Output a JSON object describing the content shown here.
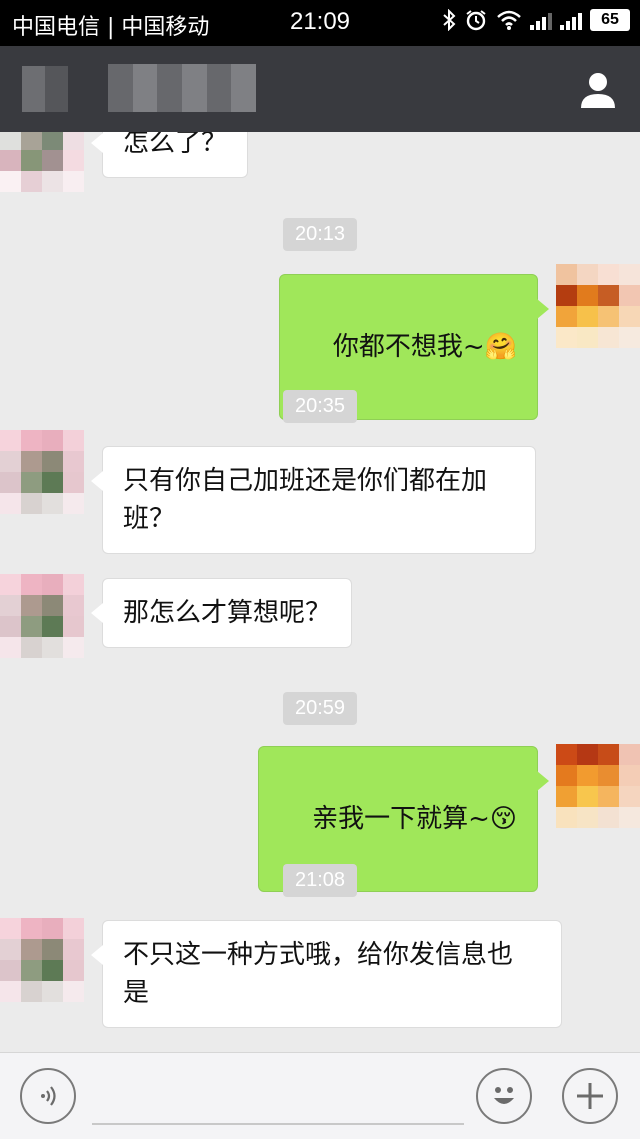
{
  "status_bar": {
    "carrier": "中国电信 | 中国移动",
    "time": "21:09",
    "bluetooth_icon": "bluetooth-icon",
    "alarm_icon": "alarm-icon",
    "battery": "65"
  },
  "header": {
    "back_icon": "blurred-back",
    "title": "",
    "profile_icon": "person-icon"
  },
  "messages": [
    {
      "type": "in",
      "text": "怎么了？"
    },
    {
      "type": "time",
      "text": "20:13"
    },
    {
      "type": "out",
      "text": "你都不想我~",
      "emoji": "🤗"
    },
    {
      "type": "time",
      "text": "20:35"
    },
    {
      "type": "in",
      "text": "只有你自己加班还是你们都在加\n班？"
    },
    {
      "type": "in",
      "text": "那怎么才算想呢？"
    },
    {
      "type": "time",
      "text": "20:59"
    },
    {
      "type": "out",
      "text": "亲我一下就算~",
      "emoji": "😚"
    },
    {
      "type": "time",
      "text": "21:08"
    },
    {
      "type": "in",
      "text": "不只这一种方式哦，给你发信息也\n是"
    }
  ],
  "input_bar": {
    "voice_icon": "voice-icon",
    "emoji_icon": "smiley-icon",
    "plus_icon": "plus-icon"
  },
  "colors": {
    "title_bar": "#393a3f",
    "chat_background": "#ebebeb",
    "out_bubble": "#a0e75a",
    "in_bubble": "#ffffff"
  }
}
